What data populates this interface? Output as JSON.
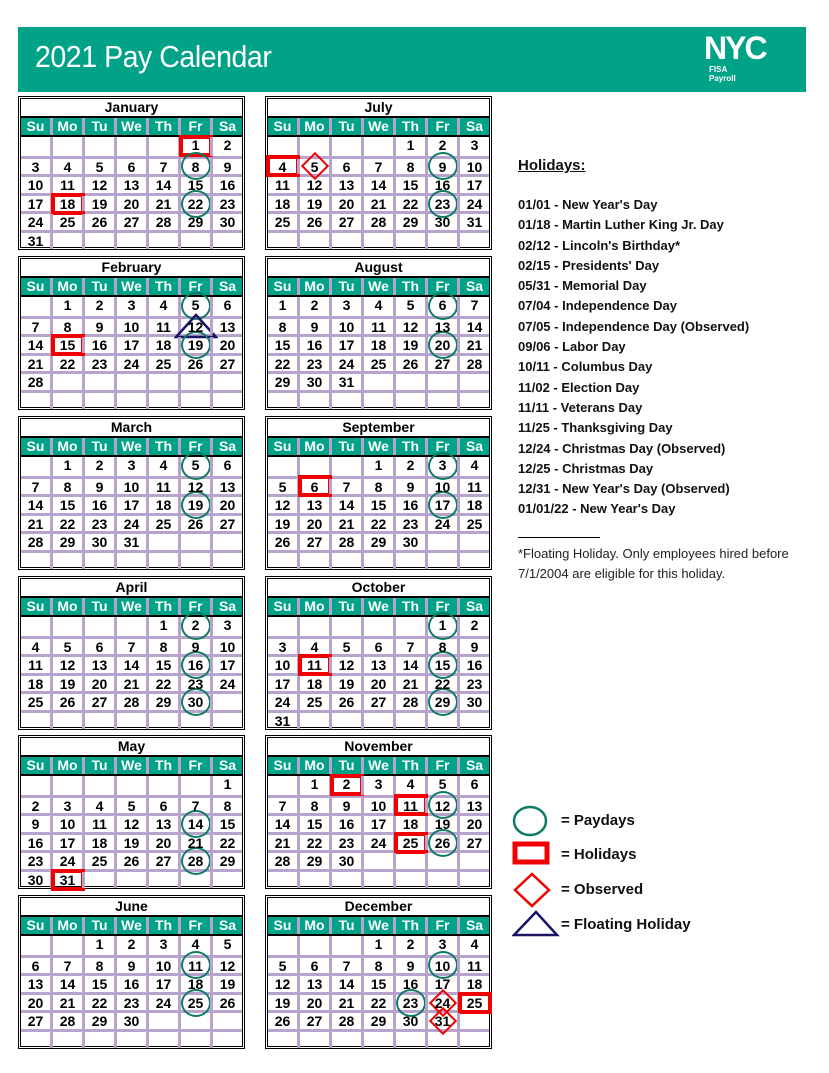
{
  "header": {
    "title": "2021 Pay Calendar",
    "logo_text": "NYC",
    "logo_sub1": "FISA",
    "logo_sub2": "Payroll"
  },
  "colors": {
    "brand": "#00A288",
    "payday": "#0E7B66",
    "holiday": "#F00000",
    "observed": "#F00000",
    "floating": "#1B1464",
    "grid": "#B8A3CC"
  },
  "weekdays": [
    "Su",
    "Mo",
    "Tu",
    "We",
    "Th",
    "Fr",
    "Sa"
  ],
  "months": [
    {
      "name": "January",
      "start": 5,
      "days": 31,
      "paydays": [
        8,
        22
      ],
      "holidays": [
        1,
        18
      ],
      "observed": [],
      "floating": []
    },
    {
      "name": "February",
      "start": 1,
      "days": 28,
      "paydays": [
        5,
        19
      ],
      "holidays": [
        15
      ],
      "observed": [],
      "floating": [
        12
      ]
    },
    {
      "name": "March",
      "start": 1,
      "days": 31,
      "paydays": [
        5,
        19
      ],
      "holidays": [],
      "observed": [],
      "floating": []
    },
    {
      "name": "April",
      "start": 4,
      "days": 30,
      "paydays": [
        2,
        16,
        30
      ],
      "holidays": [],
      "observed": [],
      "floating": []
    },
    {
      "name": "May",
      "start": 6,
      "days": 31,
      "paydays": [
        14,
        28
      ],
      "holidays": [
        31
      ],
      "observed": [],
      "floating": []
    },
    {
      "name": "June",
      "start": 2,
      "days": 30,
      "paydays": [
        11,
        25
      ],
      "holidays": [],
      "observed": [],
      "floating": []
    },
    {
      "name": "July",
      "start": 4,
      "days": 31,
      "paydays": [
        9,
        23
      ],
      "holidays": [
        4
      ],
      "observed": [
        5
      ],
      "floating": []
    },
    {
      "name": "August",
      "start": 0,
      "days": 31,
      "paydays": [
        6,
        20
      ],
      "holidays": [],
      "observed": [],
      "floating": []
    },
    {
      "name": "September",
      "start": 3,
      "days": 30,
      "paydays": [
        3,
        17
      ],
      "holidays": [
        6
      ],
      "observed": [],
      "floating": []
    },
    {
      "name": "October",
      "start": 5,
      "days": 31,
      "paydays": [
        1,
        15,
        29
      ],
      "holidays": [
        11
      ],
      "observed": [],
      "floating": []
    },
    {
      "name": "November",
      "start": 1,
      "days": 30,
      "paydays": [
        12,
        26
      ],
      "holidays": [
        2,
        11,
        25
      ],
      "observed": [],
      "floating": []
    },
    {
      "name": "December",
      "start": 3,
      "days": 31,
      "paydays": [
        10,
        23
      ],
      "holidays": [
        25
      ],
      "observed": [
        24,
        31
      ],
      "floating": []
    }
  ],
  "holidays_panel": {
    "heading": "Holidays:",
    "items": [
      "01/01 - New Year's Day",
      "01/18 - Martin Luther King Jr. Day",
      "02/12 - Lincoln's Birthday*",
      "02/15 - Presidents' Day",
      "05/31 - Memorial Day",
      "07/04 - Independence Day",
      "07/05 - Independence Day (Observed)",
      "09/06 - Labor Day",
      "10/11 - Columbus Day",
      "11/02 - Election Day",
      "11/11 - Veterans Day",
      "11/25 - Thanksgiving Day",
      "12/24 - Christmas Day (Observed)",
      "12/25 - Christmas Day",
      "12/31 - New Year's Day (Observed)",
      "01/01/22 - New Year's Day"
    ],
    "footnote": "*Floating Holiday. Only employees hired before 7/1/2004 are eligible for this holiday."
  },
  "legend": {
    "paydays": "= Paydays",
    "holidays": "= Holidays",
    "observed": "= Observed",
    "floating": "= Floating Holiday"
  }
}
